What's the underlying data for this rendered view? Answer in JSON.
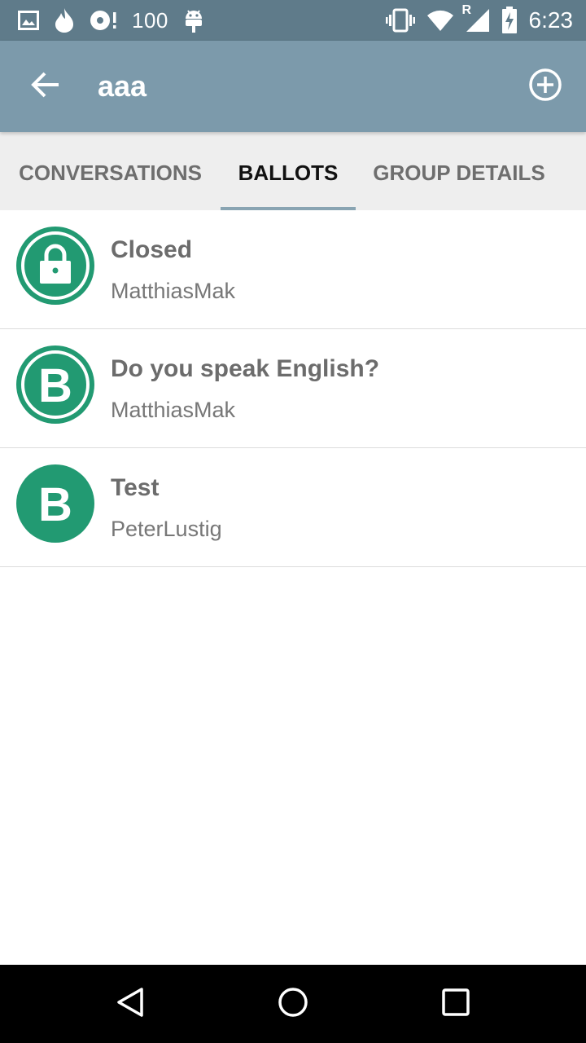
{
  "status_bar": {
    "battery_level_text": "100",
    "time": "6:23",
    "network_roaming_label": "R",
    "icons": [
      "image-icon",
      "flame-icon",
      "disc-alert-icon",
      "android-icon",
      "vibrate-icon",
      "wifi-icon",
      "signal-icon",
      "battery-charging-icon"
    ]
  },
  "app_bar": {
    "title": "aaa",
    "back_icon": "arrow-back-icon",
    "add_icon": "add-circle-icon"
  },
  "tabs": [
    {
      "label": "CONVERSATIONS",
      "active": false
    },
    {
      "label": "BALLOTS",
      "active": true
    },
    {
      "label": "GROUP DETAILS",
      "active": false
    }
  ],
  "ballots": [
    {
      "title": "Closed",
      "author": "MatthiasMak",
      "avatar": "lock-icon"
    },
    {
      "title": "Do you speak English?",
      "author": "MatthiasMak",
      "avatar_letter": "B"
    },
    {
      "title": "Test",
      "author": "PeterLustig",
      "avatar_letter": "B"
    }
  ],
  "colors": {
    "status_bar": "#5f7b8a",
    "app_bar": "#7c9aab",
    "tab_indicator": "#89a4b2",
    "avatar": "#229a72"
  }
}
